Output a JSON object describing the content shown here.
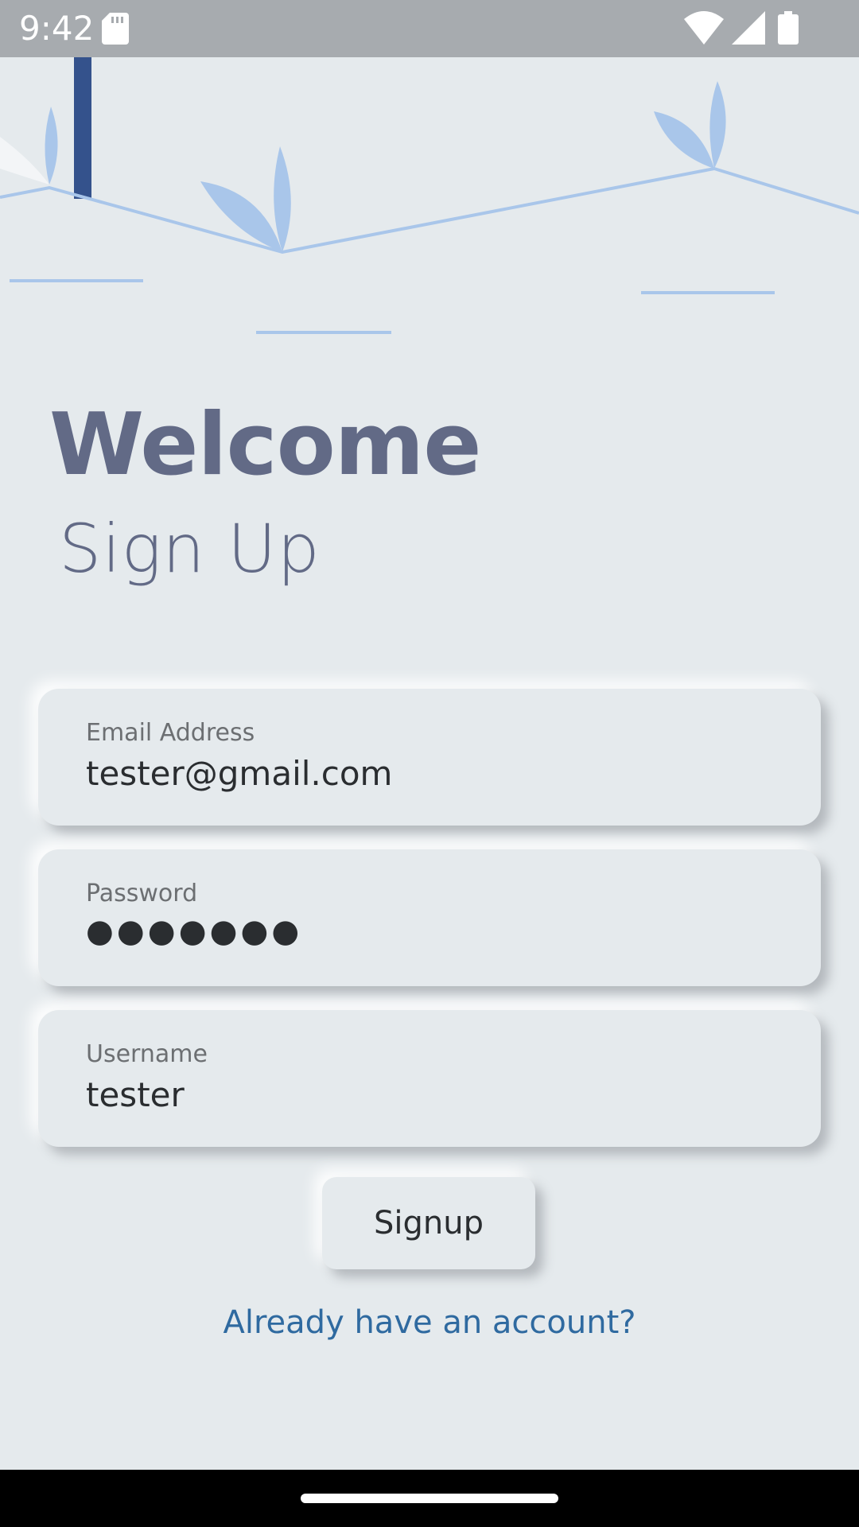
{
  "status_bar": {
    "time": "9:42",
    "icons": [
      "sd-card-icon",
      "wifi-icon",
      "signal-icon",
      "battery-icon"
    ]
  },
  "colors": {
    "background": "#e5eaed",
    "title": "#626a86",
    "link": "#2f6aa0",
    "illustration_accent": "#a9c6ea",
    "illustration_dark": "#34528c"
  },
  "header": {
    "title": "Welcome",
    "subtitle": "Sign Up"
  },
  "form": {
    "email": {
      "label": "Email Address",
      "value": "tester@gmail.com"
    },
    "password": {
      "label": "Password",
      "value": "●●●●●●●"
    },
    "username": {
      "label": "Username",
      "value": "tester"
    }
  },
  "actions": {
    "signup_label": "Signup",
    "account_link": "Already have an account?"
  }
}
